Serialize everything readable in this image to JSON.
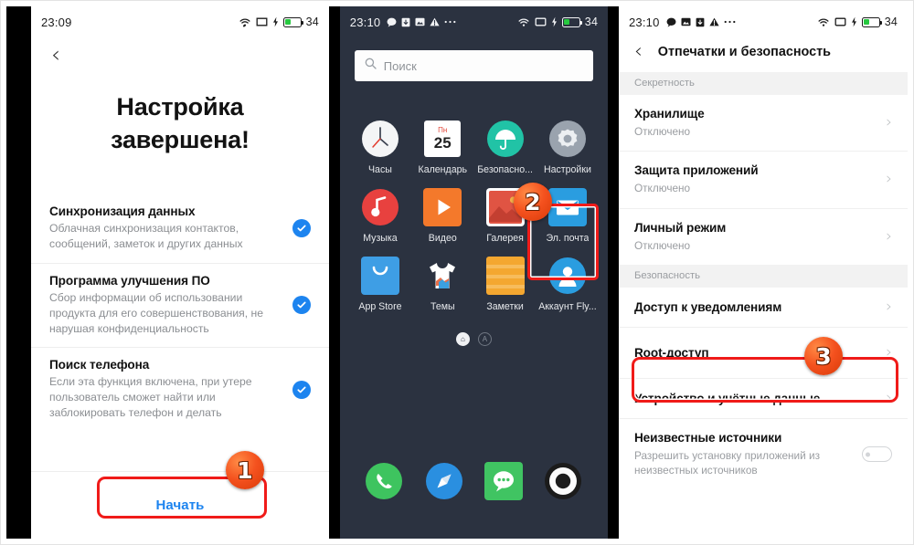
{
  "panel1": {
    "status": {
      "time": "23:09",
      "battery_percent": "34",
      "wifi_icon": "wifi-icon",
      "sim_icon": "sim-card-icon",
      "charging_icon": "charging-bolt-icon",
      "battery_icon": "battery-icon"
    },
    "back_icon": "back-chevron-icon",
    "title": "Настройка\nзавершена!",
    "title_line1": "Настройка",
    "title_line2": "завершена!",
    "items": [
      {
        "title": "Синхронизация данных",
        "subtitle": "Облачная синхронизация контактов, сообщений, заметок и других данных",
        "checked": true,
        "check_icon": "check-circle-icon"
      },
      {
        "title": "Программа улучшения ПО",
        "subtitle": "Сбор информации об использовании продукта для его совершенствования, не нарушая конфиденциальность",
        "checked": true,
        "check_icon": "check-circle-icon"
      },
      {
        "title": "Поиск телефона",
        "subtitle": "Если эта функция включена, при утере пользователь сможет найти или заблокировать телефон и делать",
        "checked": true,
        "check_icon": "check-circle-icon"
      }
    ],
    "start_button": "Начать",
    "badge": "1"
  },
  "panel2": {
    "status": {
      "time": "23:10",
      "battery_percent": "34",
      "left_icons": [
        "message-bubble-icon",
        "download-icon",
        "photo-icon",
        "warning-icon",
        "more-dots-icon"
      ]
    },
    "search": {
      "placeholder": "Поиск",
      "icon": "search-icon"
    },
    "apps": [
      {
        "label": "Часы",
        "icon": "clock-icon"
      },
      {
        "label": "Календарь",
        "icon": "calendar-icon",
        "day_label": "Пн",
        "day_number": "25"
      },
      {
        "label": "Безопасно...",
        "icon": "umbrella-security-icon"
      },
      {
        "label": "Настройки",
        "icon": "gear-icon",
        "highlighted": true
      },
      {
        "label": "Музыка",
        "icon": "music-note-icon"
      },
      {
        "label": "Видео",
        "icon": "play-icon"
      },
      {
        "label": "Галерея",
        "icon": "gallery-picture-icon"
      },
      {
        "label": "Эл. почта",
        "icon": "envelope-icon"
      },
      {
        "label": "App Store",
        "icon": "shopping-bag-icon"
      },
      {
        "label": "Темы",
        "icon": "tshirt-icon"
      },
      {
        "label": "Заметки",
        "icon": "notes-icon"
      },
      {
        "label": "Аккаунт Fly...",
        "icon": "account-person-icon"
      }
    ],
    "page_dots": [
      {
        "icon": "home-dot-icon",
        "active": true
      },
      {
        "icon": "alpha-dot-icon",
        "active": false
      }
    ],
    "dock": [
      {
        "icon": "phone-icon"
      },
      {
        "icon": "browser-compass-icon"
      },
      {
        "icon": "messages-icon"
      },
      {
        "icon": "camera-icon"
      }
    ],
    "badge": "2"
  },
  "panel3": {
    "status": {
      "time": "23:10",
      "battery_percent": "34",
      "left_icons": [
        "message-bubble-icon",
        "photo-icon",
        "download-icon",
        "warning-icon",
        "more-dots-icon"
      ]
    },
    "back_icon": "back-chevron-icon",
    "title": "Отпечатки и безопасность",
    "sections": [
      {
        "header": "Секретность",
        "rows": [
          {
            "title": "Хранилище",
            "subtitle": "Отключено",
            "chevron": "chevron-right-icon"
          },
          {
            "title": "Защита приложений",
            "subtitle": "Отключено",
            "chevron": "chevron-right-icon"
          },
          {
            "title": "Личный режим",
            "subtitle": "Отключено",
            "chevron": "chevron-right-icon"
          }
        ]
      },
      {
        "header": "Безопасность",
        "rows": [
          {
            "title": "Доступ к уведомлениям",
            "subtitle": "",
            "chevron": "chevron-right-icon"
          },
          {
            "title": "Root-доступ",
            "subtitle": "",
            "chevron": "chevron-right-icon",
            "highlighted": true
          },
          {
            "title": "Устройство и учётные данные",
            "subtitle": "",
            "chevron": "chevron-right-icon"
          },
          {
            "title": "Неизвестные источники",
            "subtitle": "Разрешить установку приложений из неизвестных источников",
            "toggle": "off"
          }
        ]
      }
    ],
    "badge": "3"
  },
  "colors": {
    "accent_blue": "#1d84ef",
    "highlight_red": "#f01b19",
    "badge_orange": "#f4511e",
    "dark_bg": "#2b3240",
    "battery_green": "#27c940"
  }
}
